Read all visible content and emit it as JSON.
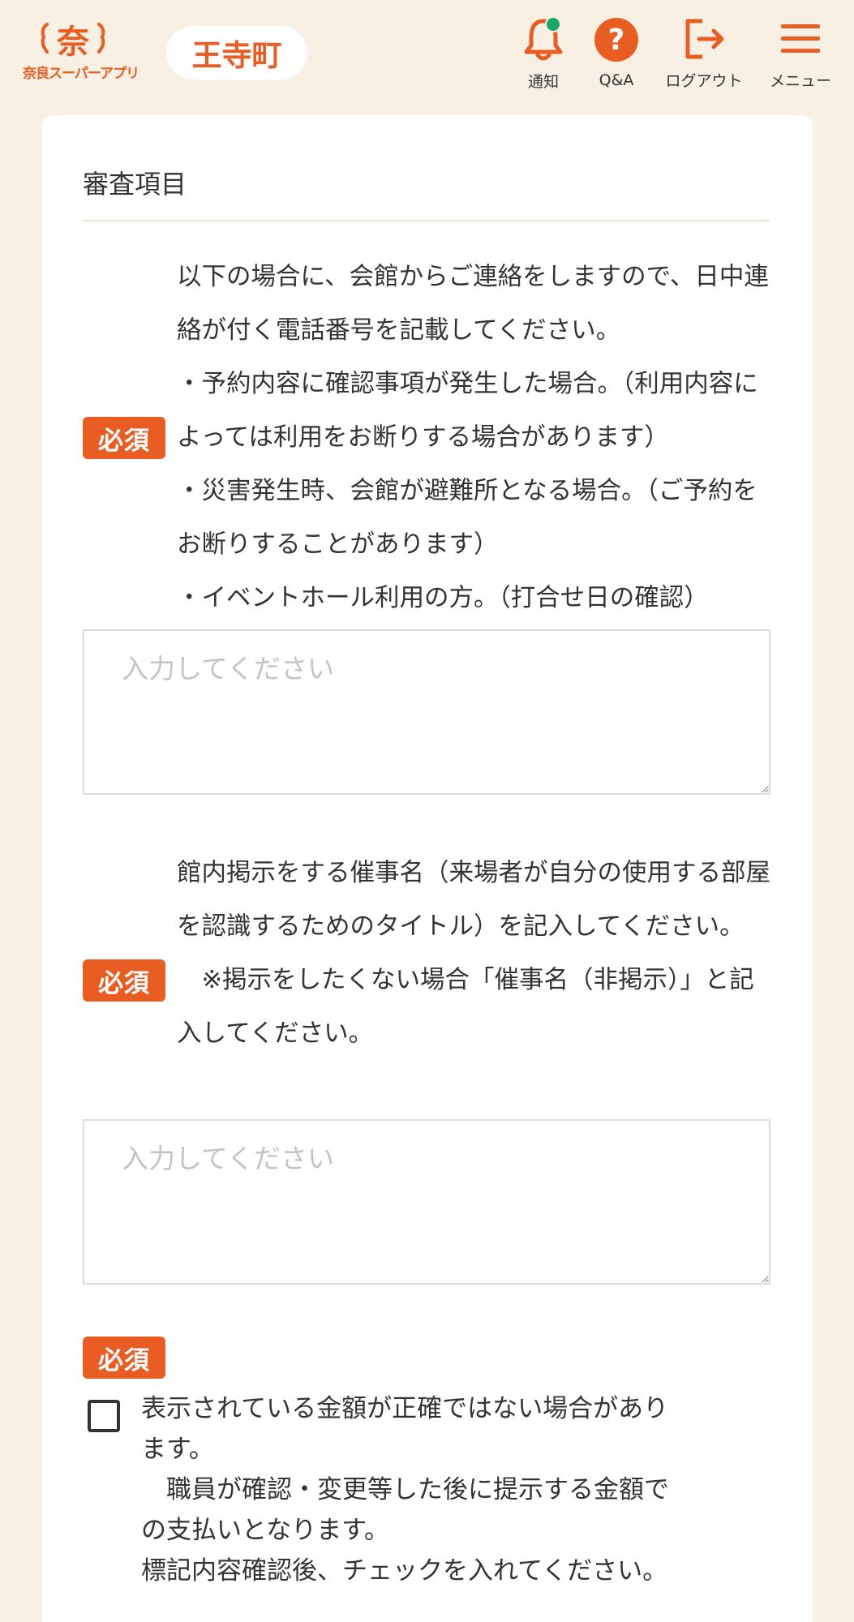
{
  "header": {
    "logo_text": "奈良スーパーアプリ",
    "logo_glyph": "奈",
    "town": "王寺町",
    "notification_label": "通知",
    "qa_label": "Q&A",
    "logout_label": "ログアウト",
    "menu_label": "メニュー",
    "accent_color": "#e95d23",
    "notification_dot_color": "#1aa56b"
  },
  "form": {
    "section_title": "審査項目",
    "required_label": "必須",
    "q1": {
      "line1": "以下の場合に、会館からご連絡をしますので、日中連絡が付く電話番号を記載してください。",
      "line2": "・予約内容に確認事項が発生した場合。（利用内容によっては利用をお断りする場合があります）",
      "line3": "・災害発生時、会館が避難所となる場合。（ご予約をお断りすることがあります）",
      "line4": "・イベントホール利用の方。（打合せ日の確認）",
      "placeholder": "入力してください"
    },
    "q2": {
      "line1": "館内掲示をする催事名（来場者が自分の使用する部屋を認識するためのタイトル）を記入してください。",
      "line2": "　※掲示をしたくない場合「催事名（非掲示）」と記入してください。",
      "placeholder": "入力してください"
    },
    "q3": {
      "line1": "表示されている金額が正確ではない場合があります。",
      "line2": "　職員が確認・変更等した後に提示する金額での支払いとなります。",
      "line3": "標記内容確認後、チェックを入れてください。",
      "checked": false
    }
  }
}
